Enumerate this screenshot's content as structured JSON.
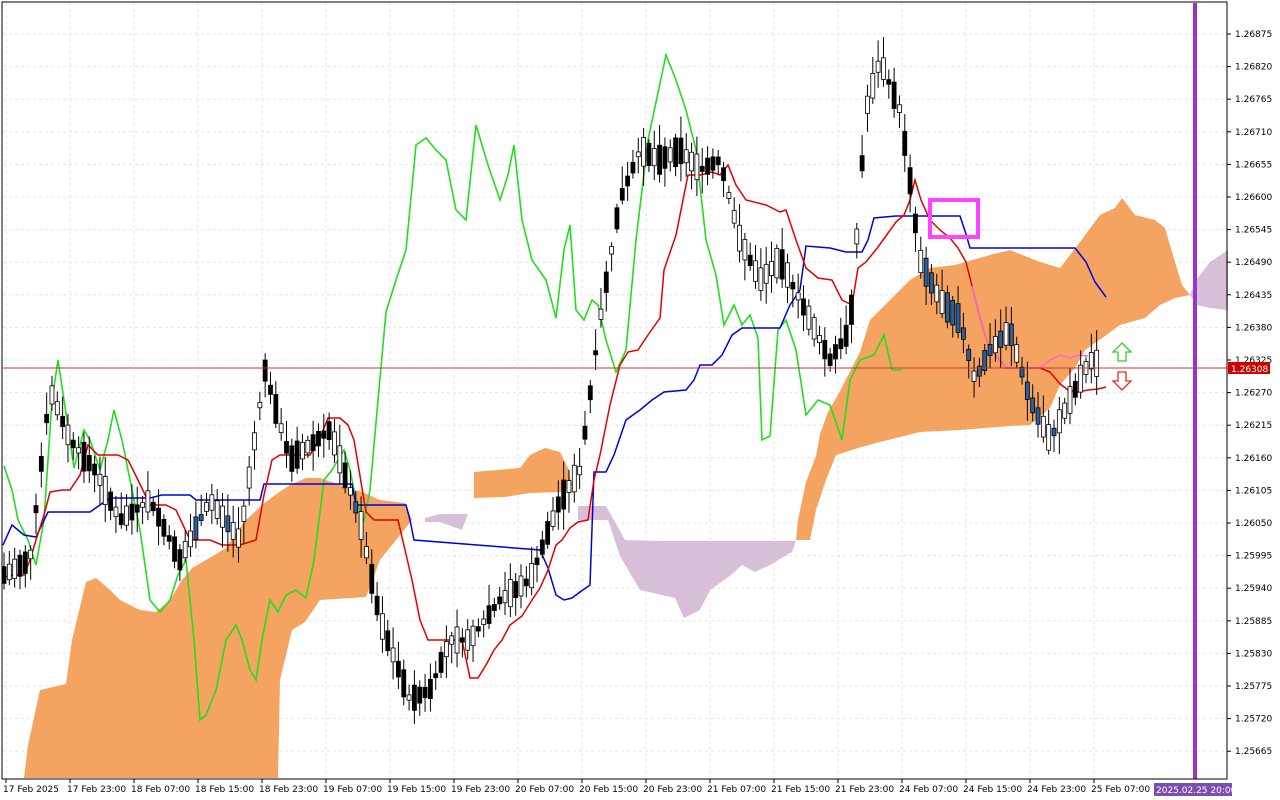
{
  "chart_data": {
    "type": "candlestick",
    "title": "",
    "y_ticks": [
      "1.26875",
      "1.26820",
      "1.26765",
      "1.26710",
      "1.26655",
      "1.26600",
      "1.26545",
      "1.26490",
      "1.26435",
      "1.26380",
      "1.26325",
      "1.26270",
      "1.26215",
      "1.26160",
      "1.26105",
      "1.26050",
      "1.25995",
      "1.25940",
      "1.25885",
      "1.25830",
      "1.25775",
      "1.25720",
      "1.25665"
    ],
    "ylim": [
      1.25628,
      1.26917
    ],
    "x_ticks": [
      "17 Feb 2025",
      "17 Feb 23:00",
      "18 Feb 07:00",
      "18 Feb 15:00",
      "18 Feb 23:00",
      "19 Feb 07:00",
      "19 Feb 15:00",
      "19 Feb 23:00",
      "20 Feb 07:00",
      "20 Feb 15:00",
      "20 Feb 23:00",
      "21 Feb 07:00",
      "21 Feb 15:00",
      "21 Feb 23:00",
      "24 Feb 07:00",
      "24 Feb 15:00",
      "24 Feb 23:00",
      "25 Feb 07:00"
    ],
    "current_price": "1.26308",
    "future_marker": "2025.02.25 20:00",
    "colors": {
      "cloud_bull": "#f4a460",
      "cloud_bear": "#d8bfd8",
      "tenkan": "#e00000",
      "kijun": "#0000dd",
      "chikou": "#22dd22",
      "bullish_candle": "#ffffff",
      "bearish_candle": "#000000",
      "highlight_box": "#ff44ff",
      "future_line": "#9933cc",
      "price_line": "#cc3333"
    },
    "annotations": [
      "highlight-box",
      "arrow-up-icon",
      "arrow-down-icon"
    ]
  }
}
